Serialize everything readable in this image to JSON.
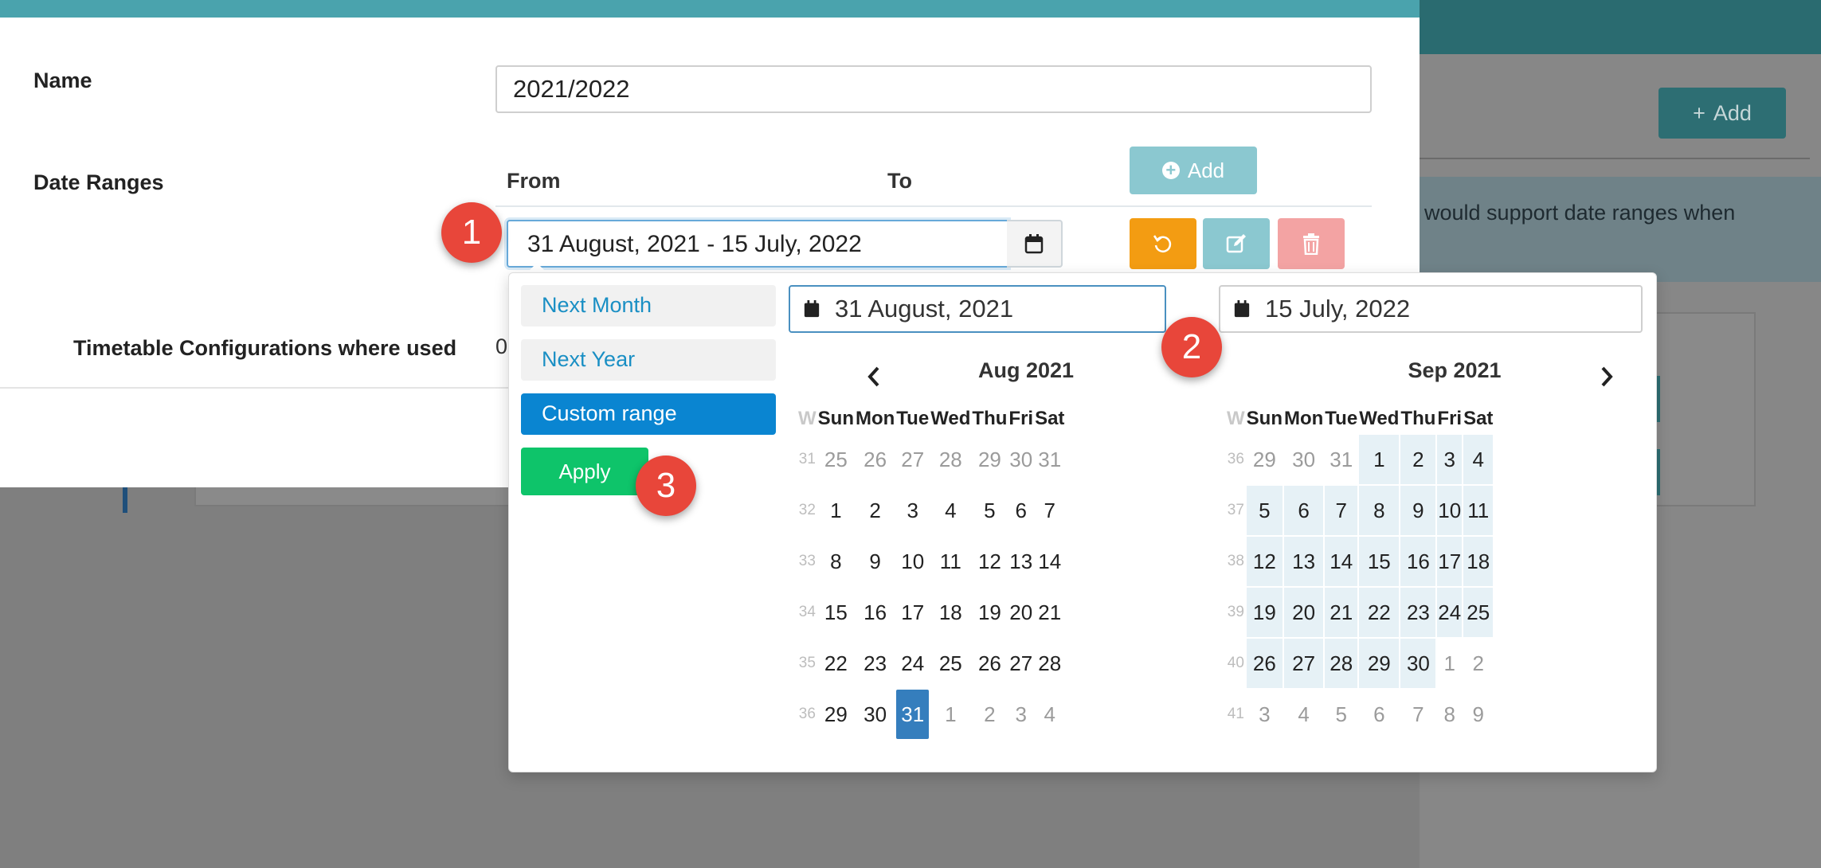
{
  "background": {
    "add_button_label": "Add",
    "info_text": "would support date ranges when"
  },
  "modal": {
    "name_label": "Name",
    "name_value": "2021/2022",
    "date_ranges_label": "Date Ranges",
    "col_from": "From",
    "col_to": "To",
    "add_button_label": "Add",
    "range_value": "31 August, 2021 - 15 July, 2022",
    "timetable_label": "Timetable Configurations where used",
    "timetable_value": "0"
  },
  "picker": {
    "presets": [
      {
        "label": "Next Month",
        "active": false
      },
      {
        "label": "Next Year",
        "active": false
      },
      {
        "label": "Custom range",
        "active": true
      }
    ],
    "apply_label": "Apply",
    "start_value": "31 August, 2021",
    "end_value": "15 July, 2022",
    "weekday_headers": [
      "W",
      "Sun",
      "Mon",
      "Tue",
      "Wed",
      "Thu",
      "Fri",
      "Sat"
    ],
    "left_month": {
      "title": "Aug 2021",
      "weeks": [
        {
          "w": "31",
          "days": [
            "25",
            "26",
            "27",
            "28",
            "29",
            "30",
            "31"
          ]
        },
        {
          "w": "32",
          "days": [
            "1",
            "2",
            "3",
            "4",
            "5",
            "6",
            "7"
          ]
        },
        {
          "w": "33",
          "days": [
            "8",
            "9",
            "10",
            "11",
            "12",
            "13",
            "14"
          ]
        },
        {
          "w": "34",
          "days": [
            "15",
            "16",
            "17",
            "18",
            "19",
            "20",
            "21"
          ]
        },
        {
          "w": "35",
          "days": [
            "22",
            "23",
            "24",
            "25",
            "26",
            "27",
            "28"
          ]
        },
        {
          "w": "36",
          "days": [
            "29",
            "30",
            "31",
            "1",
            "2",
            "3",
            "4"
          ]
        }
      ]
    },
    "right_month": {
      "title": "Sep 2021",
      "weeks": [
        {
          "w": "36",
          "days": [
            "29",
            "30",
            "31",
            "1",
            "2",
            "3",
            "4"
          ]
        },
        {
          "w": "37",
          "days": [
            "5",
            "6",
            "7",
            "8",
            "9",
            "10",
            "11"
          ]
        },
        {
          "w": "38",
          "days": [
            "12",
            "13",
            "14",
            "15",
            "16",
            "17",
            "18"
          ]
        },
        {
          "w": "39",
          "days": [
            "19",
            "20",
            "21",
            "22",
            "23",
            "24",
            "25"
          ]
        },
        {
          "w": "40",
          "days": [
            "26",
            "27",
            "28",
            "29",
            "30",
            "1",
            "2"
          ]
        },
        {
          "w": "41",
          "days": [
            "3",
            "4",
            "5",
            "6",
            "7",
            "8",
            "9"
          ]
        }
      ]
    }
  },
  "badges": [
    "1",
    "2",
    "3"
  ],
  "colors": {
    "header_teal": "#4aa3ad",
    "selected_blue": "#357ebd",
    "apply_green": "#0ec46a",
    "undo_orange": "#f39c12",
    "badge_red": "#e8463a"
  },
  "icons": [
    "plus-icon",
    "calendar-icon",
    "undo-icon",
    "edit-icon",
    "trash-icon",
    "chevron-left-icon",
    "chevron-right-icon"
  ]
}
